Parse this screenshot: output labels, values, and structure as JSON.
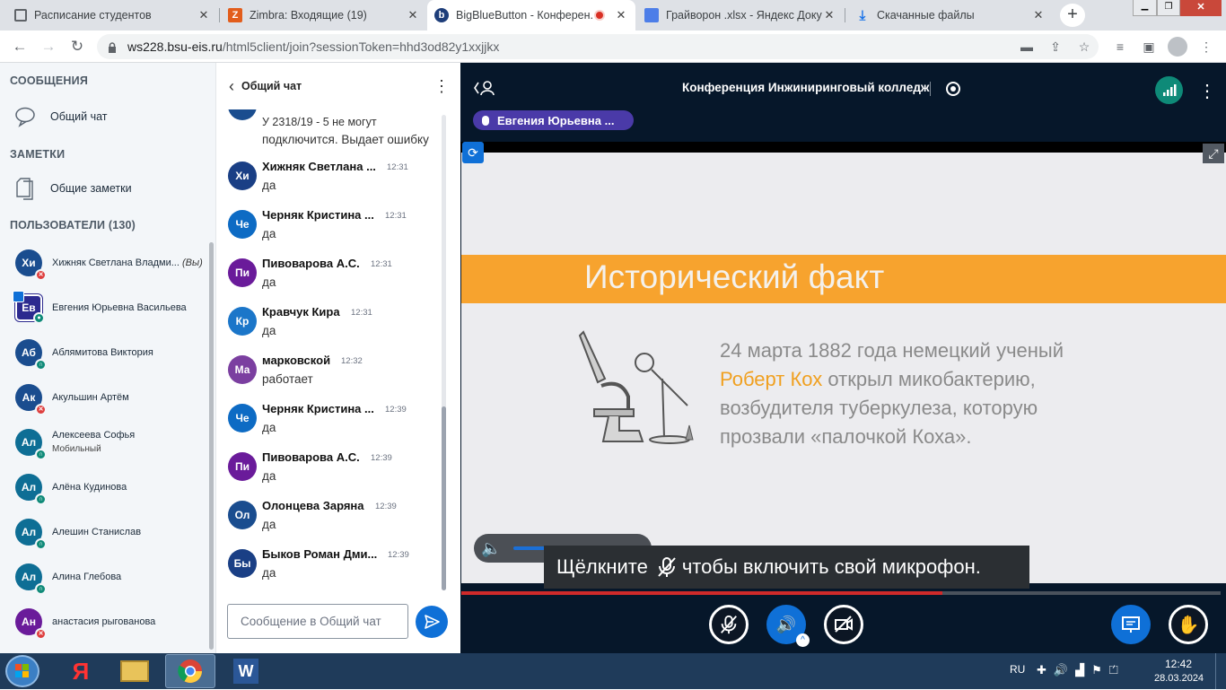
{
  "browser": {
    "tabs": [
      {
        "title": "Расписание студентов",
        "icon": "schedule-icon"
      },
      {
        "title": "Zimbra: Входящие (19)",
        "icon": "zimbra-icon"
      },
      {
        "title": "BigBlueButton - Конферен...",
        "icon": "bigbluebutton-icon",
        "active": true
      },
      {
        "title": "Грайворон .xlsx - Яндекс Доку",
        "icon": "yandex-docs-icon"
      },
      {
        "title": "Скачанные файлы",
        "icon": "download-icon"
      }
    ],
    "url_host": "ws228.bsu-eis.ru",
    "url_path": "/html5client/join?sessionToken=hhd3od82y1xxjjkx"
  },
  "sidebar": {
    "messages_header": "СООБЩЕНИЯ",
    "public_chat": "Общий чат",
    "notes_header": "ЗАМЕТКИ",
    "shared_notes": "Общие заметки",
    "users_header": "ПОЛЬЗОВАТЕЛИ",
    "users_count": "(130)",
    "users": [
      {
        "initials": "Хи",
        "name": "Хижняк Светлана Владми...",
        "you": "(Вы)",
        "status": "muted"
      },
      {
        "initials": "Ев",
        "name": "Евгения Юрьевна Васильева",
        "status": "talking",
        "presenter": true
      },
      {
        "initials": "Аб",
        "name": "Аблямитова Виктория",
        "status": "listen"
      },
      {
        "initials": "Ак",
        "name": "Акульшин Артём",
        "status": "muted"
      },
      {
        "initials": "Ал",
        "name": "Алексеева Софья",
        "sub": "Мобильный",
        "status": "listen"
      },
      {
        "initials": "Ал",
        "name": "Алёна Кудинова",
        "status": "listen"
      },
      {
        "initials": "Ал",
        "name": "Алешин Станислав",
        "status": "listen"
      },
      {
        "initials": "Ал",
        "name": "Алина Глебова",
        "status": "listen"
      },
      {
        "initials": "Ан",
        "name": "анастасия рыгованова",
        "status": "muted"
      }
    ]
  },
  "chat": {
    "title": "Общий чат",
    "partial_text_1": "У 2318/19 - 5 не могут",
    "partial_text_2": "подключится. Выдает ошибку",
    "messages": [
      {
        "initials": "Хи",
        "name": "Хижняк Светлана ...",
        "time": "12:31",
        "text": "да",
        "color": "#1a3f85"
      },
      {
        "initials": "Че",
        "name": "Черняк Кристина ...",
        "time": "12:31",
        "text": "да",
        "color": "#0d6bc4"
      },
      {
        "initials": "Пи",
        "name": "Пивоварова А.С.",
        "time": "12:31",
        "text": "да",
        "color": "#6a1b9a"
      },
      {
        "initials": "Кр",
        "name": "Кравчук Кира",
        "time": "12:31",
        "text": "да",
        "color": "#1b76c9"
      },
      {
        "initials": "Ма",
        "name": "марковской",
        "time": "12:32",
        "text": "работает",
        "color": "#7b3fa0"
      },
      {
        "initials": "Че",
        "name": "Черняк Кристина ...",
        "time": "12:39",
        "text": "да",
        "color": "#0d6bc4"
      },
      {
        "initials": "Пи",
        "name": "Пивоварова А.С.",
        "time": "12:39",
        "text": "да",
        "color": "#6a1b9a"
      },
      {
        "initials": "Ол",
        "name": "Олонцева Заряна",
        "time": "12:39",
        "text": "да",
        "color": "#1a4d8f"
      },
      {
        "initials": "Бы",
        "name": "Быков Роман Дми...",
        "time": "12:39",
        "text": "да",
        "color": "#1a3f85"
      }
    ],
    "input_placeholder": "Сообщение в Общий чат"
  },
  "meeting": {
    "title": "Конференция Инжиниринговый колледж",
    "talking_user": "Евгения Юрьевна ...",
    "mic_hint": "Щёлкните",
    "mic_hint_rest": "чтобы включить свой микрофон.",
    "slide": {
      "title": "Исторический факт",
      "line1": "24 марта 1882 года немецкий ученый",
      "line2_highlight": "Роберт Кох",
      "line2_rest": " открыл микобактерию,",
      "line3": "возбудителя туберкулеза, которую",
      "line4": "прозвали «палочкой Коха»."
    }
  },
  "taskbar": {
    "lang": "RU",
    "time": "12:42",
    "date": "28.03.2024"
  },
  "colors": {
    "accent": "#0f70d7",
    "meeting_bg": "#06172a",
    "slide_band": "#f7a32e",
    "highlight_text": "#f0a020"
  }
}
